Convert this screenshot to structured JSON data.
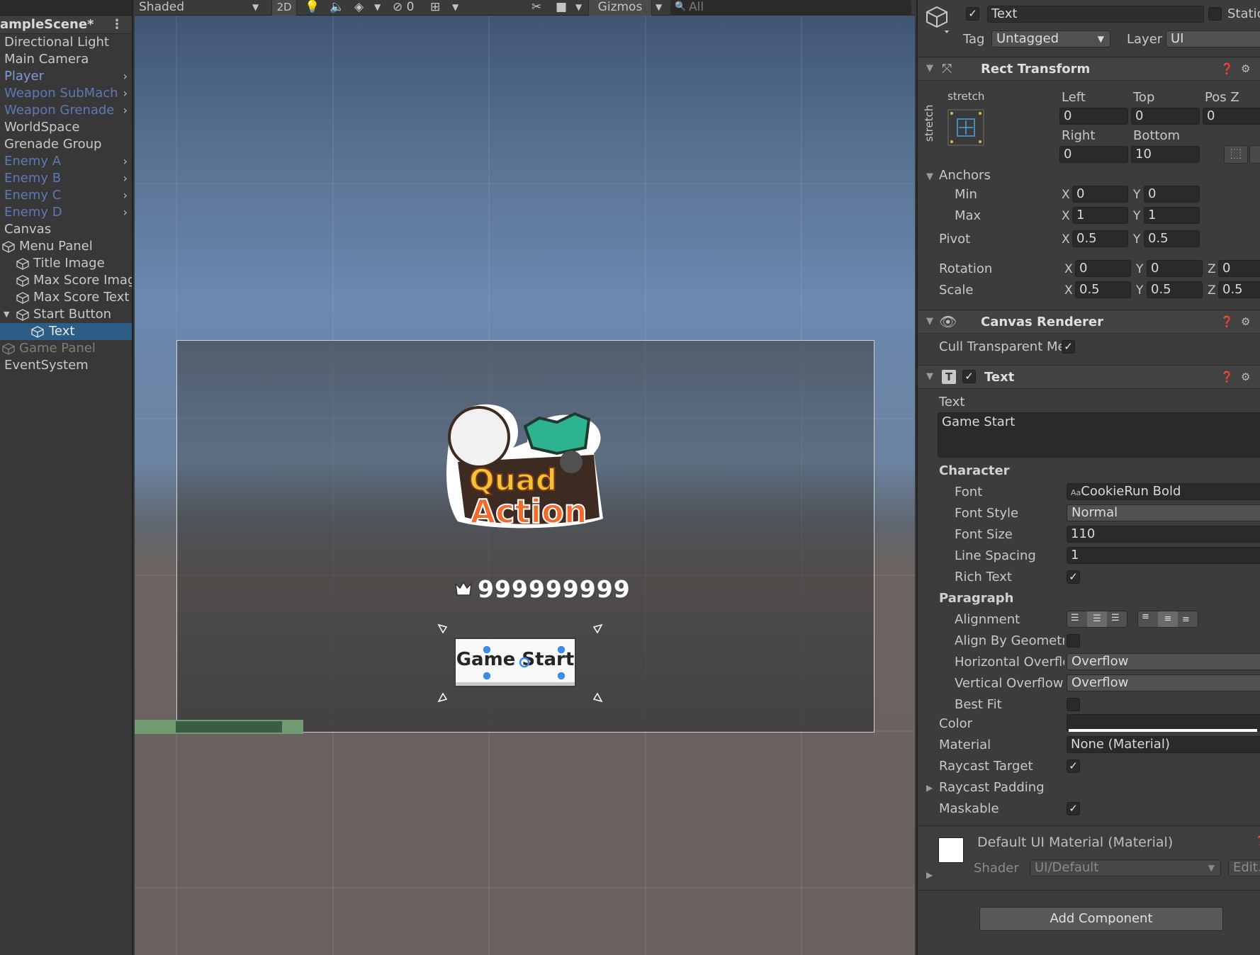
{
  "hierarchy": {
    "scene_title": "ampleScene*",
    "menu_icon": "kebab-menu-icon",
    "items": [
      {
        "label": "Directional Light"
      },
      {
        "label": "Main Camera"
      },
      {
        "label": "Player"
      },
      {
        "label": "Weapon SubMach"
      },
      {
        "label": "Weapon Grenade"
      },
      {
        "label": "WorldSpace"
      },
      {
        "label": "Grenade Group"
      },
      {
        "label": "Enemy A"
      },
      {
        "label": "Enemy B"
      },
      {
        "label": "Enemy C"
      },
      {
        "label": "Enemy D"
      },
      {
        "label": "Canvas"
      },
      {
        "label": "Menu Panel"
      },
      {
        "label": "Title Image"
      },
      {
        "label": "Max Score Imag"
      },
      {
        "label": "Max Score Text"
      },
      {
        "label": "Start Button"
      },
      {
        "label": "Text"
      },
      {
        "label": "Game Panel"
      },
      {
        "label": "EventSystem"
      }
    ]
  },
  "scene_toolbar": {
    "shading_mode": "Shaded",
    "mode_2d": "2D",
    "hidden_count": "0",
    "gizmos": "Gizmos",
    "search_placeholder": "All"
  },
  "scene": {
    "logo_line1": "Quad",
    "logo_line2": "Action",
    "max_score": "999999999",
    "start_button_label": "Game Start"
  },
  "inspector": {
    "object_name": "Text",
    "static_label": "Static",
    "tag_label": "Tag",
    "tag_value": "Untagged",
    "layer_label": "Layer",
    "layer_value": "UI",
    "rect_transform": {
      "title": "Rect Transform",
      "anchor_preset_h": "stretch",
      "anchor_preset_v": "stretch",
      "left_label": "Left",
      "left": "0",
      "top_label": "Top",
      "top": "0",
      "posz_label": "Pos Z",
      "posz": "0",
      "right_label": "Right",
      "right": "0",
      "bottom_label": "Bottom",
      "bottom": "10",
      "anchors_label": "Anchors",
      "min_label": "Min",
      "min_x": "0",
      "min_y": "0",
      "max_label": "Max",
      "max_x": "1",
      "max_y": "1",
      "pivot_label": "Pivot",
      "pivot_x": "0.5",
      "pivot_y": "0.5",
      "rotation_label": "Rotation",
      "rot_x": "0",
      "rot_y": "0",
      "rot_z": "0",
      "scale_label": "Scale",
      "scale_x": "0.5",
      "scale_y": "0.5",
      "scale_z": "0.5",
      "axis_x": "X",
      "axis_y": "Y",
      "axis_z": "Z"
    },
    "canvas_renderer": {
      "title": "Canvas Renderer",
      "cull_label": "Cull Transparent Me",
      "cull_checked": true
    },
    "text_component": {
      "title": "Text",
      "text_label": "Text",
      "text_value": "Game Start",
      "character_label": "Character",
      "font_label": "Font",
      "font_value": "CookieRun Bold",
      "font_style_label": "Font Style",
      "font_style_value": "Normal",
      "font_size_label": "Font Size",
      "font_size_value": "110",
      "line_spacing_label": "Line Spacing",
      "line_spacing_value": "1",
      "rich_text_label": "Rich Text",
      "paragraph_label": "Paragraph",
      "alignment_label": "Alignment",
      "align_geometry_label": "Align By Geometry",
      "h_overflow_label": "Horizontal Overflow",
      "h_overflow_value": "Overflow",
      "v_overflow_label": "Vertical Overflow",
      "v_overflow_value": "Overflow",
      "best_fit_label": "Best Fit",
      "color_label": "Color",
      "color_value": "#ffffff",
      "material_label": "Material",
      "material_value": "None (Material)",
      "raycast_target_label": "Raycast Target",
      "raycast_padding_label": "Raycast Padding",
      "maskable_label": "Maskable"
    },
    "material_preview": {
      "name": "Default UI Material (Material)",
      "shader_label": "Shader",
      "shader_value": "UI/Default",
      "edit_label": "Edit..."
    },
    "add_component": "Add Component"
  }
}
